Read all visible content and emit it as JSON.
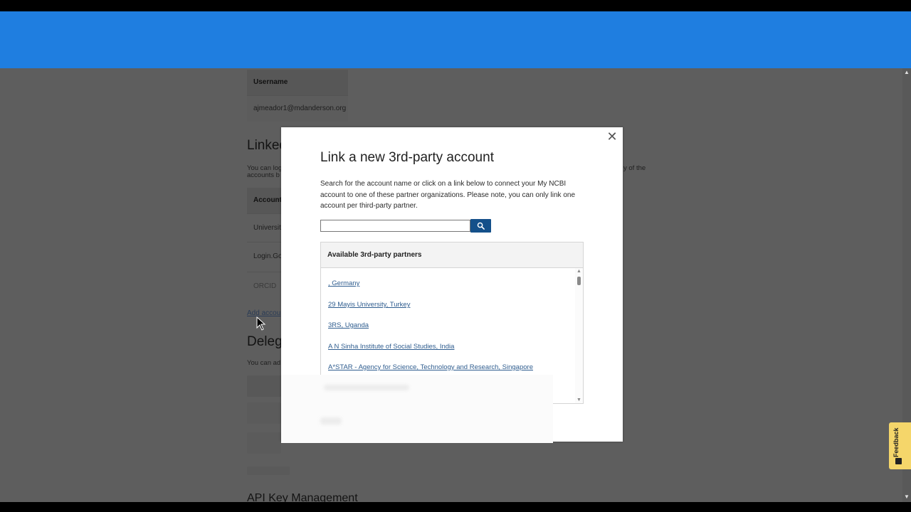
{
  "background": {
    "username_header": "Username",
    "username_value": "ajmeador1@mdanderson.org",
    "linked_heading": "Linked",
    "linked_desc_1": "You can log",
    "linked_desc_2": "accounts b",
    "linked_desc_right": "y of the",
    "account_header": "Account",
    "accounts": [
      "Universit",
      "Login.Gov",
      "ORCID"
    ],
    "add_account_link": "Add accou",
    "delegates_heading": "Deleg",
    "delegates_desc": "You can ad",
    "api_heading": "API Key Management"
  },
  "modal": {
    "title": "Link a new 3rd-party account",
    "description": "Search for the account name or click on a link below to connect your My NCBI account to one of these partner organizations. Please note, you can only link one account per third-party partner.",
    "search_placeholder": "",
    "partners_header": "Available 3rd-party partners",
    "partners": [
      ", Germany",
      "29 Mayis University, Turkey",
      "3RS, Uganda",
      "A N Sinha Institute of Social Studies, India",
      "A*STAR - Agency for Science, Technology and Research, Singapore"
    ]
  },
  "feedback": {
    "label": "Feedback"
  },
  "colors": {
    "header_blue": "#1f7ee0",
    "search_button": "#14508a",
    "link": "#2f5d8f",
    "feedback_bg": "#f5d66a"
  },
  "icons": {
    "close": "close-icon",
    "search": "search-icon",
    "feedback": "feedback-icon"
  }
}
